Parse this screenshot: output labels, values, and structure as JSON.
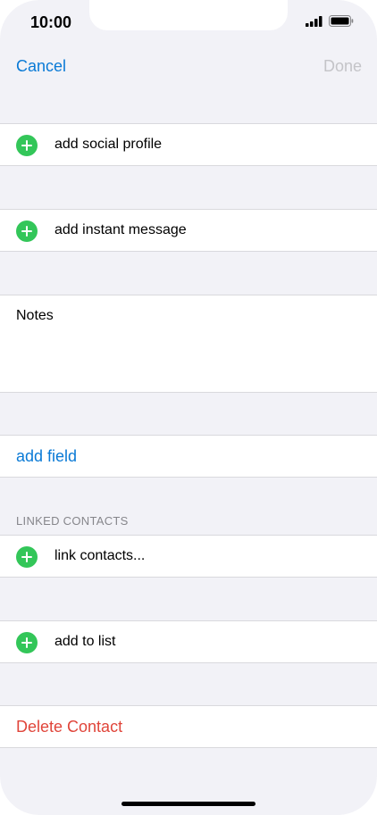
{
  "status_bar": {
    "time": "10:00"
  },
  "nav": {
    "cancel_label": "Cancel",
    "done_label": "Done"
  },
  "rows": {
    "social_profile": "add social profile",
    "instant_message": "add instant message",
    "notes_label": "Notes",
    "add_field": "add field",
    "linked_contacts_header": "LINKED CONTACTS",
    "link_contacts": "link contacts...",
    "add_to_list": "add to list",
    "delete_contact": "Delete Contact"
  },
  "colors": {
    "accent": "#0a7ad6",
    "add_green": "#33c659",
    "danger": "#e0453a",
    "disabled": "#c4c4c8",
    "background": "#f2f2f7"
  }
}
